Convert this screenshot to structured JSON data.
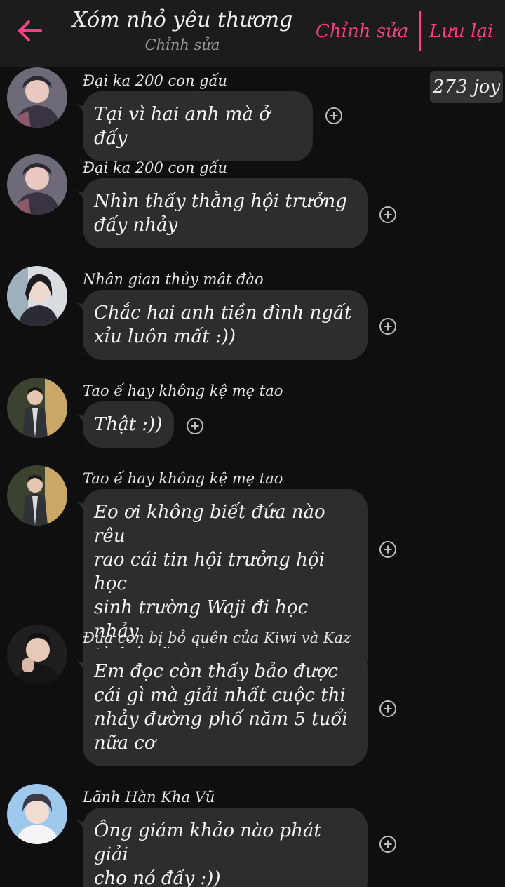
{
  "header": {
    "title": "Xóm nhỏ yêu thương",
    "subtitle": "Chỉnh sửa",
    "edit_label": "Chỉnh sửa",
    "save_label": "Lưu lại"
  },
  "badge": {
    "text": "273 joy"
  },
  "colors": {
    "accent": "#ff3d86",
    "bubble": "#2d2d2d",
    "background": "#0f0f0f",
    "header": "#1c1c1c"
  },
  "messages": [
    {
      "sender": "Đại ka 200 con gấu",
      "text": "Tại vì hai anh mà ở đấy",
      "avatar_icon": "avatar-photo"
    },
    {
      "sender": "Đại ka 200 con gấu",
      "text": "Nhìn thấy thằng hội trưởng\nđấy nhảy",
      "avatar_icon": "avatar-photo"
    },
    {
      "sender": "Nhân gian thủy mật đào",
      "text": "Chắc hai anh tiền đình ngất\nxỉu luôn mất :))",
      "avatar_icon": "avatar-photo"
    },
    {
      "sender": "Tao ế hay không kệ mẹ tao",
      "text": "Thật :))",
      "avatar_icon": "avatar-photo"
    },
    {
      "sender": "Tao ế hay không kệ mẹ tao",
      "text": "Eo ơi không biết đứa nào rêu\nrao cái tin hội trưởng hội học\nsinh trường Waji đi học nhảy\ntừ bé nữa :))",
      "avatar_icon": "avatar-photo"
    },
    {
      "sender": "Đứa con bị bỏ quên của Kiwi và Kaz",
      "text": "Em đọc còn thấy bảo được\ncái gì mà giải nhất cuộc thi\nnhảy đường phố năm 5 tuổi\nnữa cơ",
      "avatar_icon": "avatar-photo"
    },
    {
      "sender": "Lãnh Hàn Kha Vũ",
      "text": "Ông giám khảo nào phát giải\ncho nó đấy :))",
      "avatar_icon": "avatar-photo"
    }
  ]
}
